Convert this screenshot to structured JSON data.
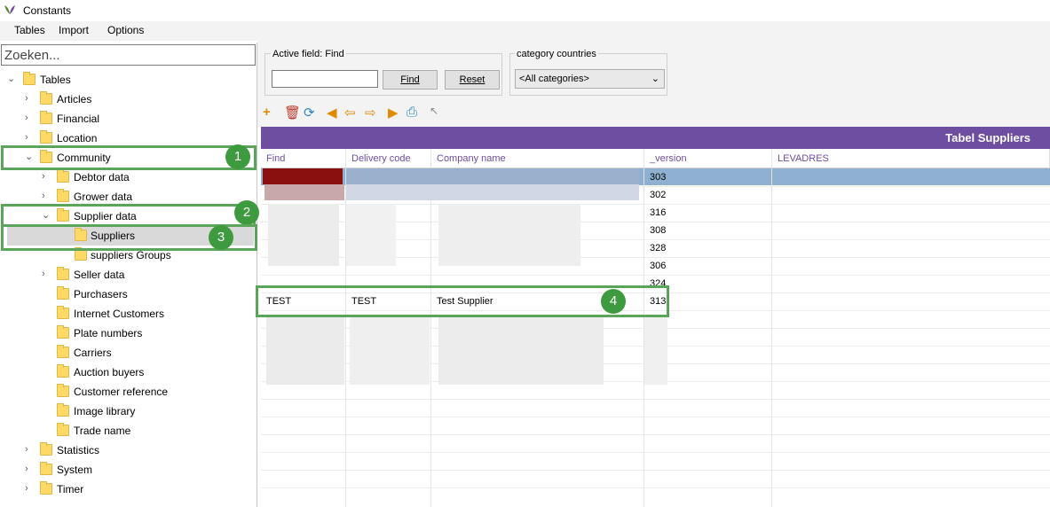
{
  "window": {
    "title": "Constants"
  },
  "menu": {
    "items": [
      "Tables",
      "Import",
      "Options"
    ]
  },
  "search": {
    "placeholder": "Zoeken..."
  },
  "tree": [
    {
      "label": "Tables"
    },
    {
      "label": "Articles"
    },
    {
      "label": "Financial"
    },
    {
      "label": "Location"
    },
    {
      "label": "Community"
    },
    {
      "label": "Debtor data"
    },
    {
      "label": "Grower data"
    },
    {
      "label": "Supplier data"
    },
    {
      "label": "Suppliers"
    },
    {
      "label": "suppliers Groups"
    },
    {
      "label": "Seller data"
    },
    {
      "label": "Purchasers"
    },
    {
      "label": "Internet Customers"
    },
    {
      "label": "Plate numbers"
    },
    {
      "label": "Carriers"
    },
    {
      "label": "Auction buyers"
    },
    {
      "label": "Customer reference"
    },
    {
      "label": "Image library"
    },
    {
      "label": "Trade name"
    },
    {
      "label": "Statistics"
    },
    {
      "label": "System"
    },
    {
      "label": "Timer"
    }
  ],
  "badges": [
    "1",
    "2",
    "3",
    "4"
  ],
  "filter": {
    "active_field_label": "Active field: Find",
    "find_value": "",
    "find_button": "Find",
    "reset_button": "Reset",
    "category_label": "category countries",
    "category_value": "<All categories>"
  },
  "table": {
    "title": "Tabel Suppliers",
    "columns": [
      "Find",
      "Delivery code",
      "Company name",
      "_version",
      "LEVADRES"
    ],
    "versions": [
      "303",
      "302",
      "316",
      "308",
      "328",
      "306",
      "324"
    ],
    "test_row": {
      "find": "TEST",
      "delivery_code": "TEST",
      "company_name": "Test Supplier",
      "version": "313"
    }
  },
  "colors": {
    "accent": "#6e4ea0",
    "highlight": "#5aa55a",
    "selection": "#8fb0d0"
  }
}
